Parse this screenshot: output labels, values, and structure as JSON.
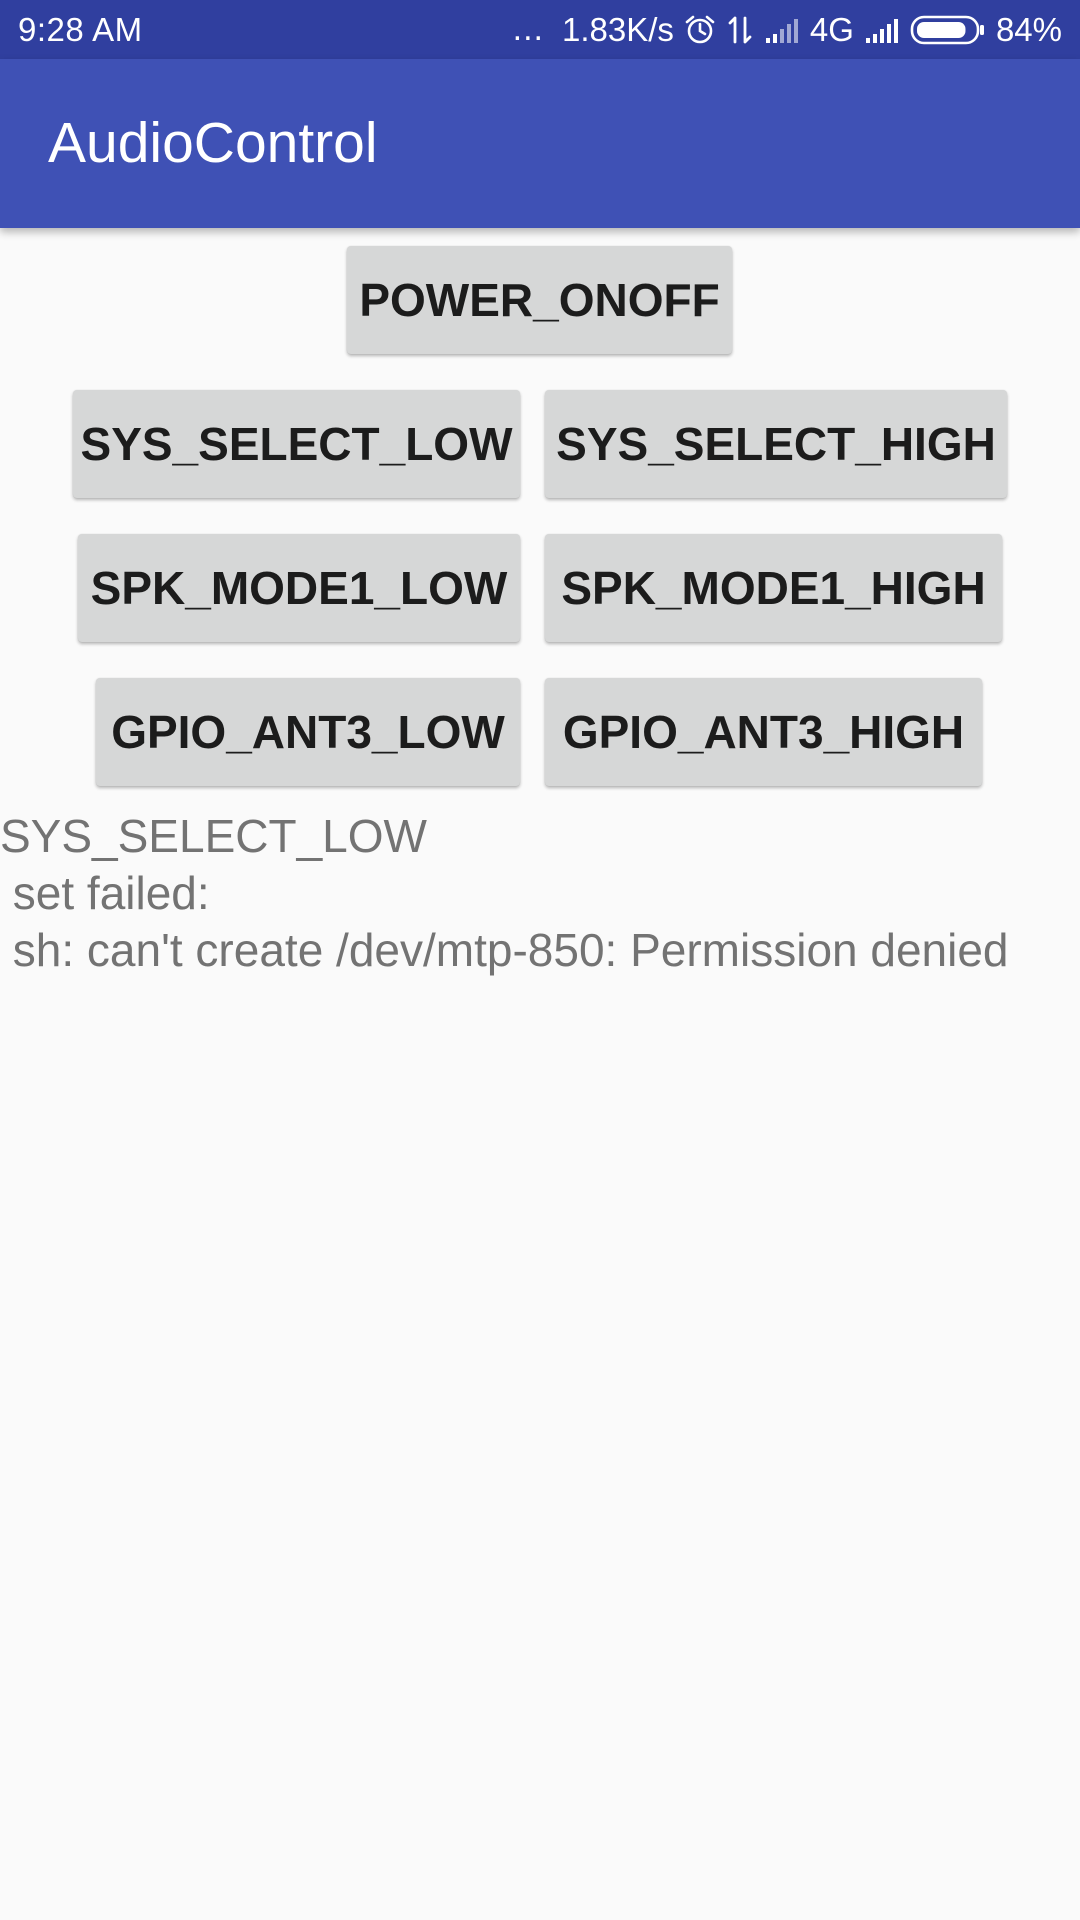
{
  "status_bar": {
    "time": "9:28  AM",
    "more_indicator": "...",
    "network_speed": "1.83K/s",
    "network_type": "4G",
    "battery_percent": "84%",
    "battery_level": 0.84,
    "icons": [
      "alarm-icon",
      "data-transfer-icon",
      "signal-icon",
      "signal-icon",
      "battery-icon"
    ]
  },
  "app_bar": {
    "title": "AudioControl"
  },
  "buttons": {
    "power_onoff": "POWER_ONOFF",
    "sys_select_low": "SYS_SELECT_LOW",
    "sys_select_high": "SYS_SELECT_HIGH",
    "spk_mode1_low": "SPK_MODE1_LOW",
    "spk_mode1_high": "SPK_MODE1_HIGH",
    "gpio_ant3_low": "GPIO_ANT3_LOW",
    "gpio_ant3_high": "GPIO_ANT3_HIGH"
  },
  "output": {
    "line1": "SYS_SELECT_LOW",
    "line2": " set failed:",
    "line3": " sh: can't create /dev/mtp-850: Permission denied"
  },
  "colors": {
    "status_bar": "#303f9f",
    "app_bar": "#3f51b5",
    "background": "#fafafa",
    "button": "#d6d7d7",
    "output_text": "#737373"
  }
}
